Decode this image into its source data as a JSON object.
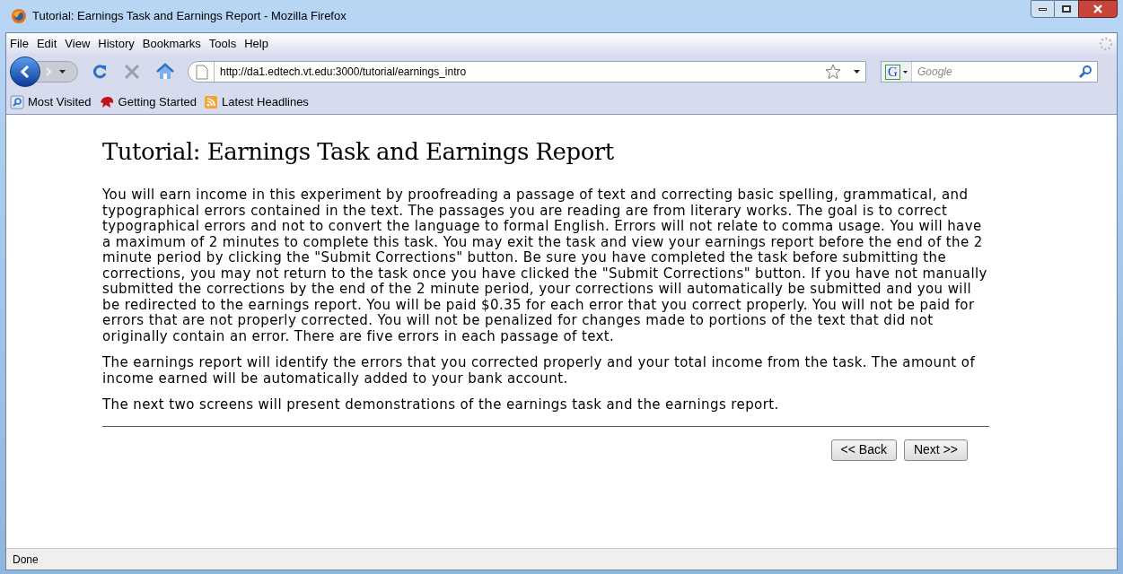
{
  "window": {
    "title": "Tutorial: Earnings Task and Earnings Report - Mozilla Firefox"
  },
  "menu": [
    "File",
    "Edit",
    "View",
    "History",
    "Bookmarks",
    "Tools",
    "Help"
  ],
  "address": {
    "value": "http://da1.edtech.vt.edu:3000/tutorial/earnings_intro"
  },
  "search": {
    "placeholder": "Google",
    "engine": "G"
  },
  "bookmarks": [
    "Most Visited",
    "Getting Started",
    "Latest Headlines"
  ],
  "page": {
    "heading": "Tutorial: Earnings Task and Earnings Report",
    "paragraphs": [
      "You will earn income in this experiment by proofreading a passage of text and correcting basic spelling, grammatical, and typographical errors contained in the text. The passages you are reading are from literary works. The goal is to correct typographical errors and not to convert the language to formal English. Errors will not relate to comma usage. You will have a maximum of 2 minutes to complete this task. You may exit the task and view your earnings report before the end of the 2 minute period by clicking the \"Submit Corrections\" button. Be sure you have completed the task before submitting the corrections, you may not return to the task once you have clicked the \"Submit Corrections\" button. If you have not manually submitted the corrections by the end of the 2 minute period, your corrections will automatically be submitted and you will be redirected to the earnings report. You will be paid $0.35 for each error that you correct properly. You will not be paid for errors that are not properly corrected. You will not be penalized for changes made to portions of the text that did not originally contain an error. There are five errors in each passage of text.",
      "The earnings report will identify the errors that you corrected properly and your total income from the task. The amount of income earned will be automatically added to your bank account.",
      "The next two screens will present demonstrations of the earnings task and the earnings report."
    ],
    "buttons": [
      "<< Back",
      "Next >>"
    ]
  },
  "status_bar": "Done"
}
